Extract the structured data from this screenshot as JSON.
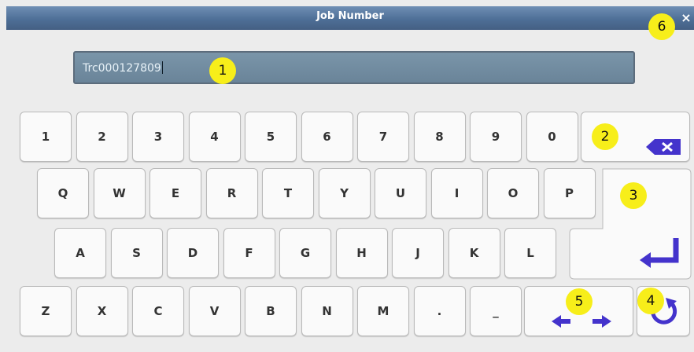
{
  "window": {
    "title": "Job Number",
    "close_glyph": "×"
  },
  "input": {
    "value": "Trc000127809"
  },
  "keys": {
    "row1": [
      "1",
      "2",
      "3",
      "4",
      "5",
      "6",
      "7",
      "8",
      "9",
      "0"
    ],
    "row2": [
      "Q",
      "W",
      "E",
      "R",
      "T",
      "Y",
      "U",
      "I",
      "O",
      "P"
    ],
    "row3": [
      "A",
      "S",
      "D",
      "F",
      "G",
      "H",
      "J",
      "K",
      "L"
    ],
    "row4": [
      "Z",
      "X",
      "C",
      "V",
      "B",
      "N",
      "M",
      ".",
      "_"
    ]
  },
  "icons": {
    "backspace": "backspace-icon",
    "enter": "enter-icon",
    "cursor_move": "left-right-arrows-icon",
    "undo": "rotate-icon",
    "close": "close-icon"
  },
  "annotations": [
    "1",
    "2",
    "3",
    "4",
    "5",
    "6"
  ],
  "colors": {
    "titlebar": "#4e6f97",
    "field": "#6a8499",
    "badge": "#f7ee1a",
    "icon": "#4433cc"
  }
}
